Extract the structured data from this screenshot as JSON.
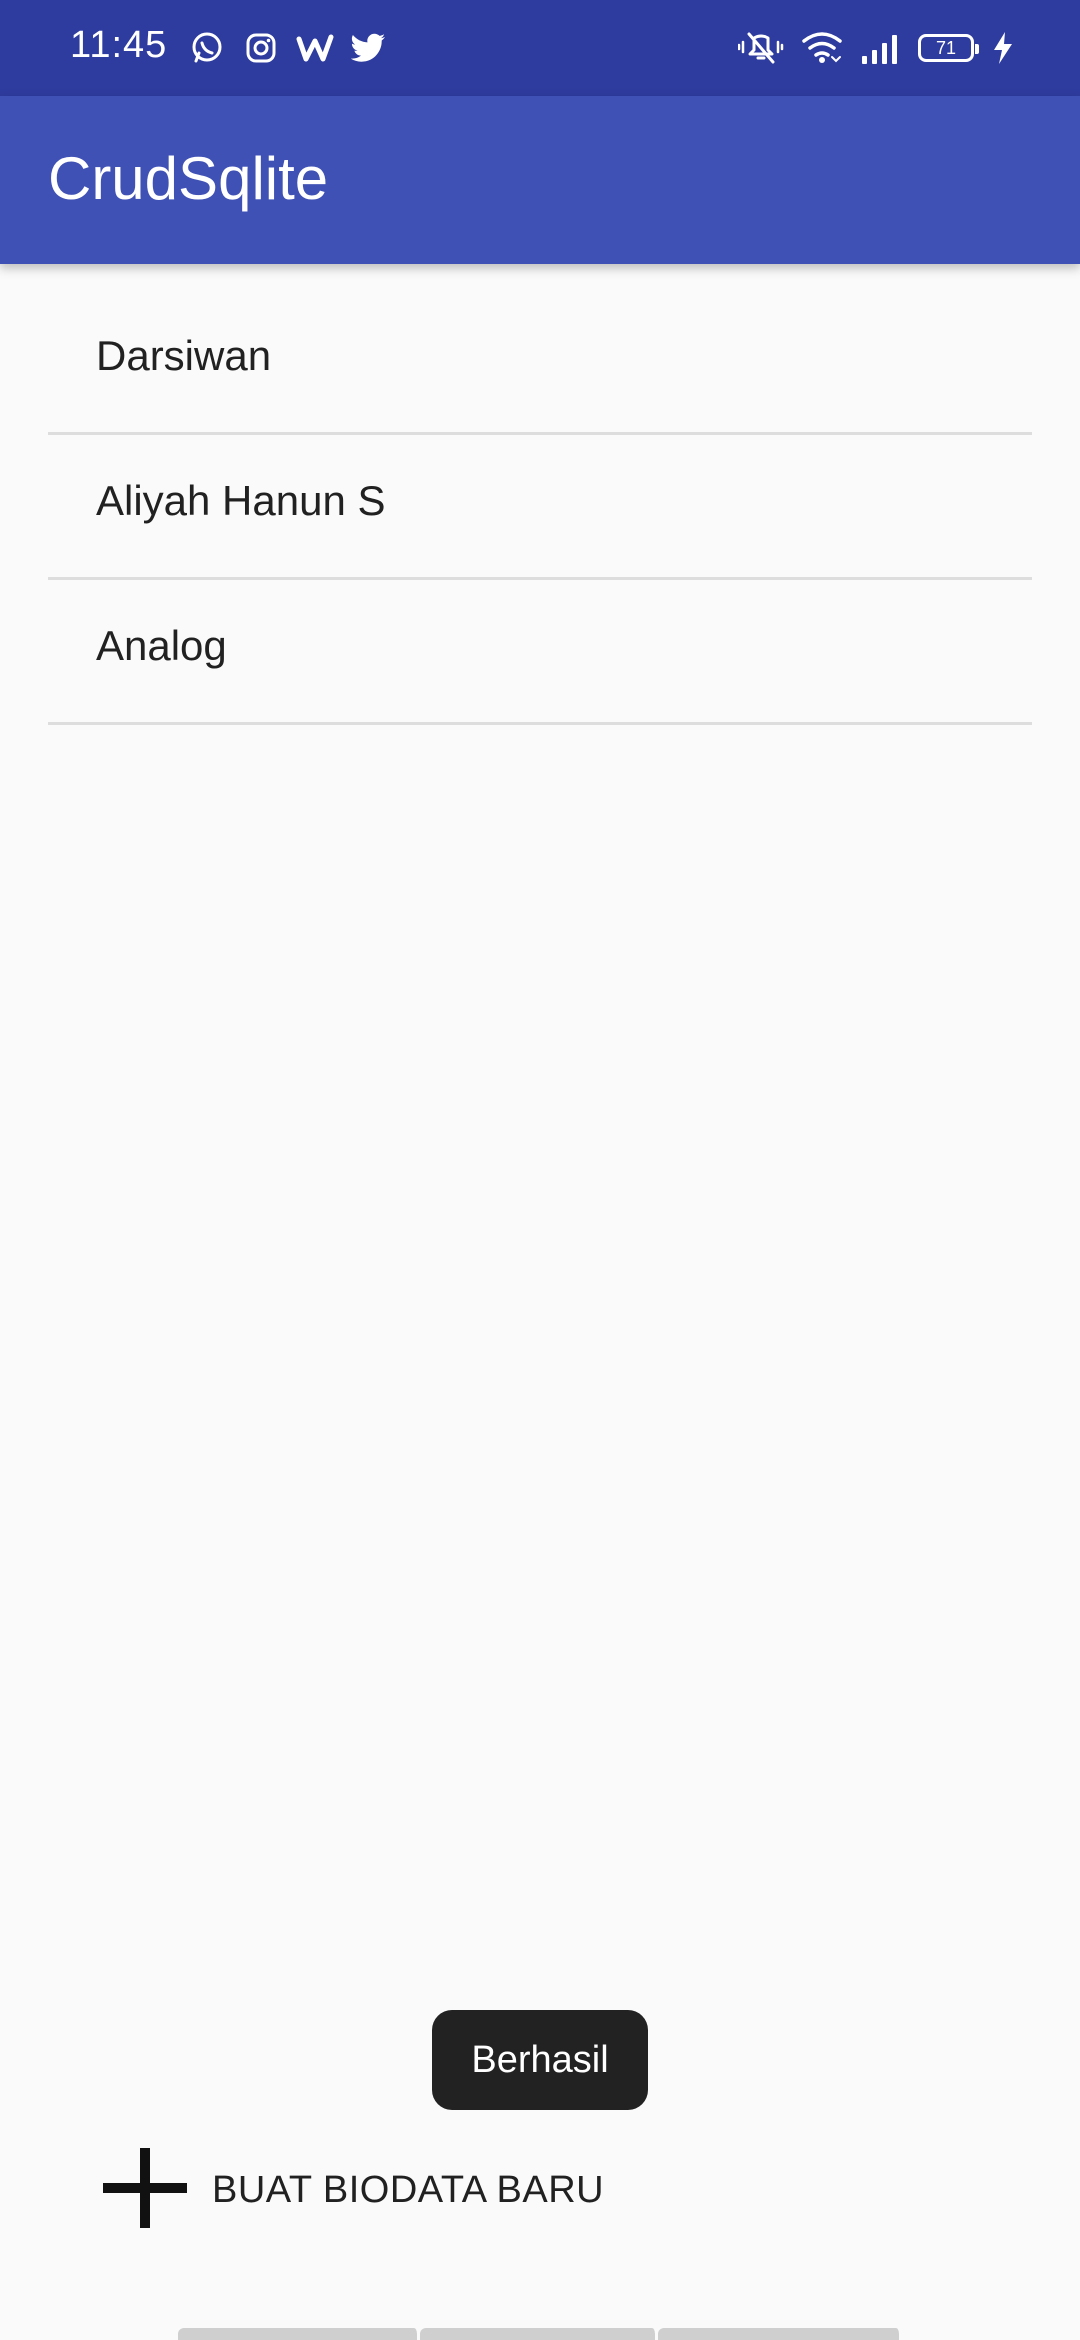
{
  "status_bar": {
    "time": "11:45",
    "battery_level": "71",
    "app_icons": [
      "whatsapp-icon",
      "instagram-icon",
      "webtoon-icon",
      "twitter-icon"
    ],
    "system_icons": [
      "vibrate-mute-icon",
      "wifi-icon",
      "signal-icon",
      "battery-icon",
      "charging-icon"
    ]
  },
  "app_bar": {
    "title": "CrudSqlite"
  },
  "list": {
    "items": [
      {
        "label": "Darsiwan"
      },
      {
        "label": "Aliyah Hanun S"
      },
      {
        "label": "Analog"
      }
    ]
  },
  "toast": {
    "message": "Berhasil"
  },
  "create_button": {
    "label": "BUAT BIODATA BARU",
    "icon": "plus-icon"
  },
  "colors": {
    "status_bar": "#2f3c9f",
    "app_bar": "#3f51b5",
    "background": "#fafafa",
    "toast": "#222222"
  }
}
